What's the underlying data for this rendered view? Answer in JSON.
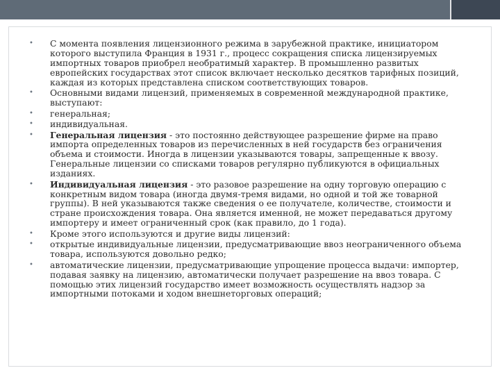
{
  "slide": {
    "items": [
      {
        "bold": "",
        "text": "С момента появления лицензионного режима в зарубежной практике, инициатором которого выступила Франция в 1931 г., процесс сокращения списка лицензируемых импортных товаров приобрел необратимый характер. В промышленно развитых европейских государствах этот список включает несколько десятков тарифных позиций, каждая из которых представлена списком соответствующих товаров."
      },
      {
        "bold": "",
        "text": "Основными видами лицензий, применяемых в современной международной практике, выступают:"
      },
      {
        "bold": "",
        "text": "генеральная;"
      },
      {
        "bold": "",
        "text": "индивидуальная."
      },
      {
        "bold": "Генеральная лицензия",
        "text": " - это постоянно действующее разрешение фирме на право импорта определенных товаров из перечисленных в ней государств без ограничения объема и стоимости. Иногда в лицензии указываются товары, запрещенные к ввозу. Генеральные лицензии со списками товаров регулярно публикуются в официальных изданиях."
      },
      {
        "bold": "Индивидуальная лицензия",
        "text": " - это разовое разрешение на одну торговую операцию с конкретным видом товара (иногда двумя-тремя видами, но одной и той же товарной группы). В ней указываются также сведения о ее получателе, количестве, стоимости и стране происхождения товара. Она является именной, не может передаваться другому импортеру и имеет ограниченный срок (как правило, до 1 года)."
      },
      {
        "bold": "",
        "text": "Кроме этого используются и другие виды лицензий:"
      },
      {
        "bold": "",
        "text": "открытые индивидуальные лицензии, предусматривающие ввоз неограниченного объема товара, используются довольно редко;"
      },
      {
        "bold": "",
        "text": "автоматические лицензии, предусматривающие упрощение процесса выдачи: импортер, подавая заявку на лицензию, автоматически получает разрешение на ввоз товара. С помощью этих лицензий государство имеет возможность осуществлять надзор за импортными потоками и ходом внешнеторговых операций;"
      }
    ]
  }
}
